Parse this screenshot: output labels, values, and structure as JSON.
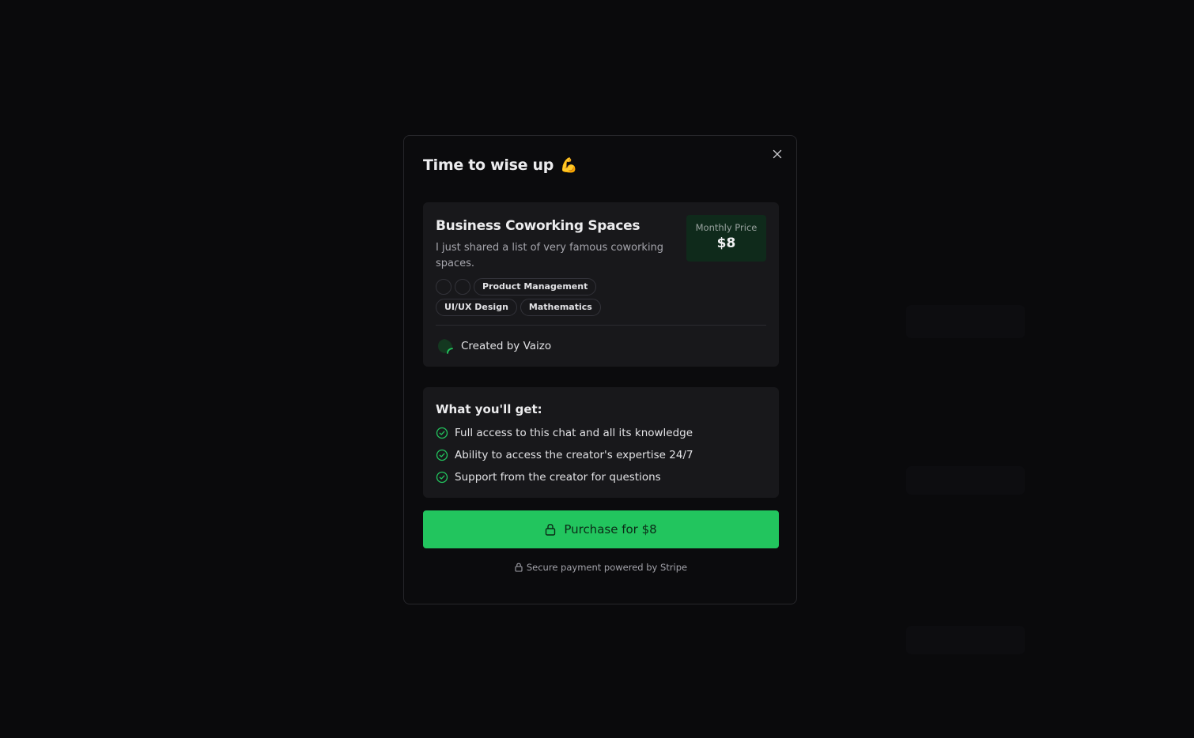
{
  "modal": {
    "title": "Time to wise up",
    "title_emoji": "💪",
    "close_icon": "close-icon"
  },
  "card": {
    "title": "Business Coworking Spaces",
    "description": "I just shared a list of very famous coworking spaces.",
    "price_label": "Monthly Price",
    "price_value": "$8",
    "tags": [
      "Product Management",
      "UI/UX Design",
      "Mathematics"
    ],
    "creator_text": "Created by Vaizo"
  },
  "benefits": {
    "title": "What you'll get:",
    "items": [
      "Full access to this chat and all its knowledge",
      "Ability to access the creator's expertise 24/7",
      "Support from the creator for questions"
    ]
  },
  "purchase": {
    "label": "Purchase for $8",
    "icon": "lock-icon"
  },
  "footer": {
    "secure_text": "Secure payment powered by Stripe"
  },
  "colors": {
    "accent": "#22c55e",
    "background": "#0a0a0c",
    "card": "#18181b",
    "price_bg": "#0f2a1b"
  }
}
